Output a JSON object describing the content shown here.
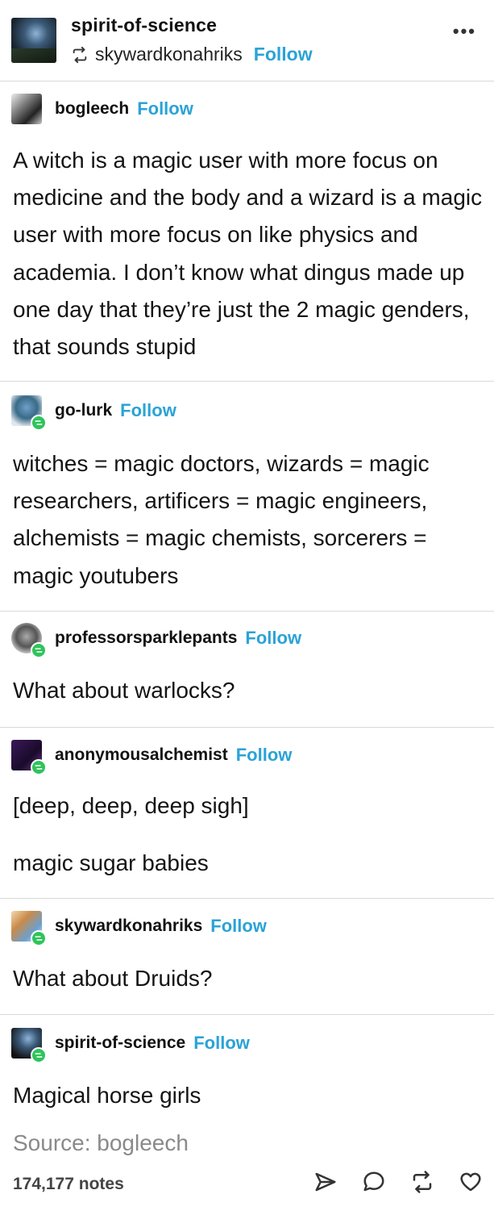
{
  "header": {
    "blog_name": "spirit-of-science",
    "reblogged_from": "skywardkonahriks",
    "follow_label": "Follow",
    "more_icon": "ellipsis-icon"
  },
  "thread": [
    {
      "username": "bogleech",
      "follow_label": "Follow",
      "paragraphs": [
        "A witch is a magic user with more focus on medicine and the body and a wizard is a magic user with more focus on like physics and academia. I don’t know what dingus made up one day that they’re just the 2 magic genders, that sounds stupid"
      ]
    },
    {
      "username": "go-lurk",
      "follow_label": "Follow",
      "paragraphs": [
        "witches = magic doctors, wizards = magic researchers, artificers = magic engineers, alchemists = magic chemists, sorcerers = magic youtubers"
      ]
    },
    {
      "username": "professorsparklepants",
      "follow_label": "Follow",
      "paragraphs": [
        "What about warlocks?"
      ]
    },
    {
      "username": "anonymousalchemist",
      "follow_label": "Follow",
      "paragraphs": [
        "[deep, deep, deep sigh]",
        "magic sugar babies"
      ]
    },
    {
      "username": "skywardkonahriks",
      "follow_label": "Follow",
      "paragraphs": [
        "What about Druids?"
      ]
    },
    {
      "username": "spirit-of-science",
      "follow_label": "Follow",
      "paragraphs": [
        "Magical horse girls"
      ]
    }
  ],
  "footer": {
    "source": "Source: bogleech",
    "notes": "174,177 notes",
    "actions": [
      "share-icon",
      "reply-icon",
      "reblog-icon",
      "like-icon"
    ]
  },
  "colors": {
    "follow": "#2aa3d6",
    "reblog_badge": "#2ec45a",
    "divider": "#d9d9d9",
    "source_text": "#8a8a8a"
  }
}
